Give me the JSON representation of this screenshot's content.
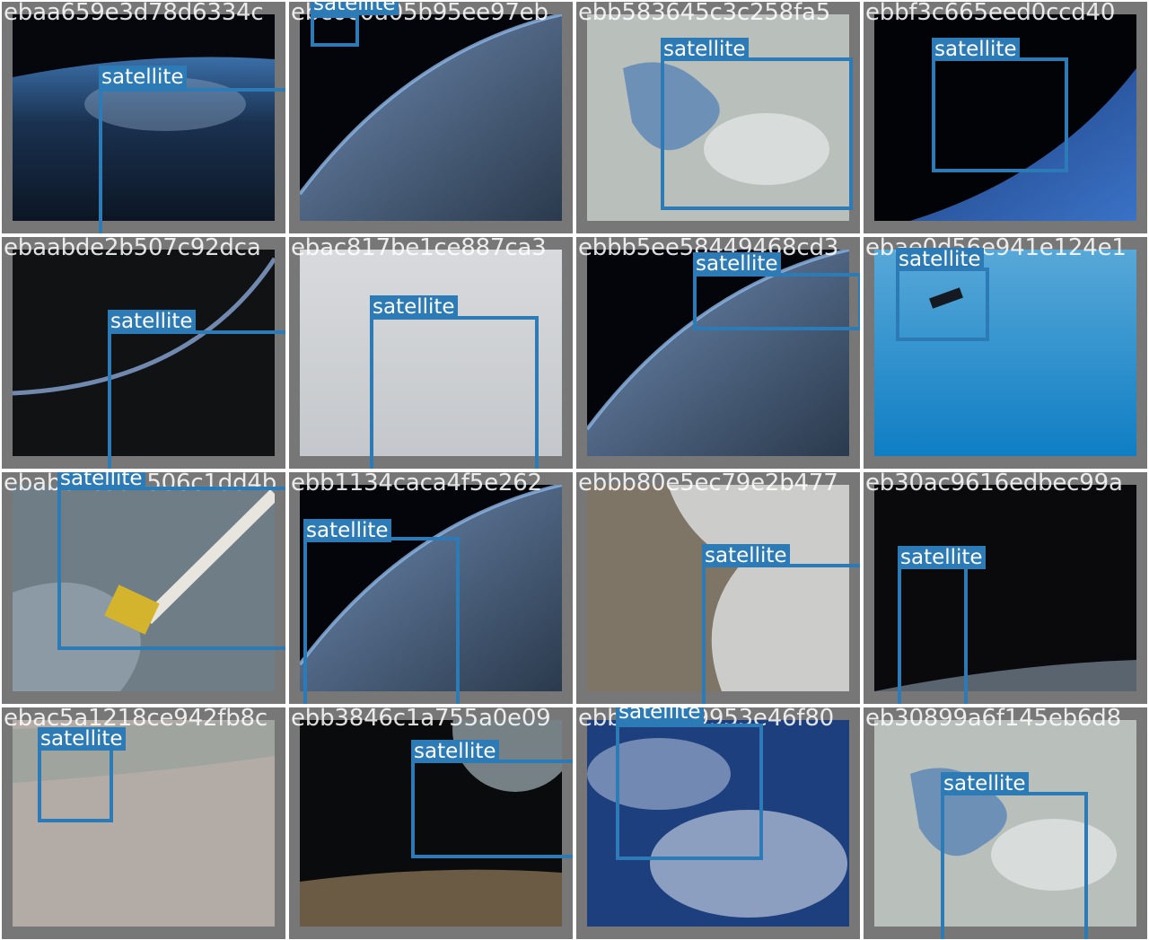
{
  "box_color": "#2c7bb6",
  "cells": [
    {
      "filename": "ebaa659e3d78d6334c",
      "label": "satellite",
      "scene": "earth-night-blue"
    },
    {
      "filename": "ebc0c0a05b95ee97eb",
      "label": "satellite",
      "scene": "earth-limb-clouds"
    },
    {
      "filename": "ebb583645c3c258fa5",
      "label": "satellite",
      "scene": "lake-aerial"
    },
    {
      "filename": "ebbf3c665eed0ccd40",
      "label": "satellite",
      "scene": "space-horizon"
    },
    {
      "filename": "ebaabde2b507c92dca",
      "label": "satellite",
      "scene": "space-arc"
    },
    {
      "filename": "ebac817be1ce887ca3",
      "label": "satellite",
      "scene": "clouds-white"
    },
    {
      "filename": "ebbb5ee58449468cd3",
      "label": "satellite",
      "scene": "earth-limb-clouds"
    },
    {
      "filename": "ebae0d56e941e124e1",
      "label": "satellite",
      "scene": "ocean-blue"
    },
    {
      "filename": "ebab62c5a1506c1dd4b",
      "label": "satellite",
      "scene": "coast-aerial"
    },
    {
      "filename": "ebb1134caca4f5e262",
      "label": "satellite",
      "scene": "earth-limb-clouds"
    },
    {
      "filename": "ebbb80e5ec79e2b477",
      "label": "satellite",
      "scene": "mountains-snow"
    },
    {
      "filename": "eb30ac9616edbec99a",
      "label": "satellite",
      "scene": "space-horizon-dark"
    },
    {
      "filename": "ebac5a1218ce942fb8c",
      "label": "satellite",
      "scene": "desert-haze"
    },
    {
      "filename": "ebb3846c1a755a0e09",
      "label": "satellite",
      "scene": "sun-glare"
    },
    {
      "filename": "ebbe0d099953e46f80",
      "label": "satellite",
      "scene": "earth-clouds-blue"
    },
    {
      "filename": "eb30899a6f145eb6d8",
      "label": "satellite",
      "scene": "lake-aerial"
    }
  ]
}
